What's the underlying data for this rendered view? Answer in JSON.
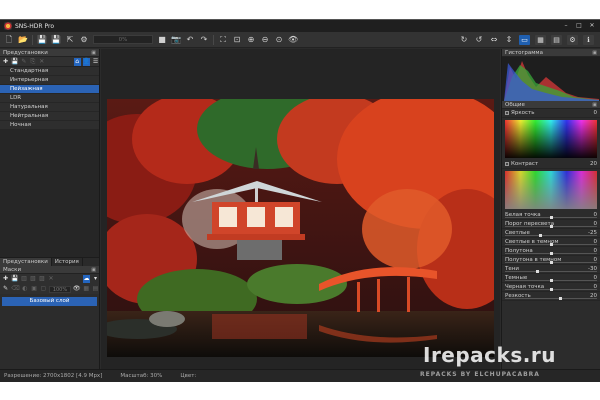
{
  "app": {
    "title": "SNS-HDR Pro",
    "win_buttons": [
      "–",
      "□",
      "✕"
    ]
  },
  "toolbar": {
    "zoom_value": "0%"
  },
  "left": {
    "presets_title": "Предустановки",
    "presets": [
      "Стандартная",
      "Интерьерная",
      "Пейзажная",
      "LDR",
      "Натуральная",
      "Нейтральная",
      "Ночная"
    ],
    "selected_preset": "Пейзажная",
    "tabs": [
      "Предустановки",
      "История"
    ],
    "masks_title": "Маски",
    "mask_opacity": "100%",
    "base_layer": "Базовый слой"
  },
  "right": {
    "histogram_title": "Гистограмма",
    "general_title": "Общие",
    "brightness_label": "Яркость",
    "brightness_value": "0",
    "contrast_label": "Контраст",
    "contrast_value": "20",
    "sliders": [
      {
        "label": "Белая точка",
        "value": "0",
        "level": 0.5
      },
      {
        "label": "Порог пересвета",
        "value": "0",
        "level": 0.5
      },
      {
        "label": "Светлые",
        "value": "-25",
        "level": 0.38
      },
      {
        "label": "Светлые в темном",
        "value": "0",
        "level": 0.5
      },
      {
        "label": "Полутона",
        "value": "0",
        "level": 0.5
      },
      {
        "label": "Полутона в темном",
        "value": "0",
        "level": 0.5
      },
      {
        "label": "Тени",
        "value": "-30",
        "level": 0.35
      },
      {
        "label": "Темные",
        "value": "0",
        "level": 0.5
      },
      {
        "label": "Черная точка",
        "value": "0",
        "level": 0.5
      },
      {
        "label": "Резкость",
        "value": "20",
        "level": 0.6
      }
    ]
  },
  "status": {
    "resolution": "Разрешение: 2700x1802 [4.9 Mpx]",
    "zoom": "Масштаб: 30%",
    "color": "Цвет:"
  },
  "watermark": {
    "main": "Irepacks.ru",
    "sub": "REPACKS BY ELCHUPACABRA"
  },
  "colors": {
    "accent": "#2b63b5",
    "panel": "#2c2c2c"
  }
}
